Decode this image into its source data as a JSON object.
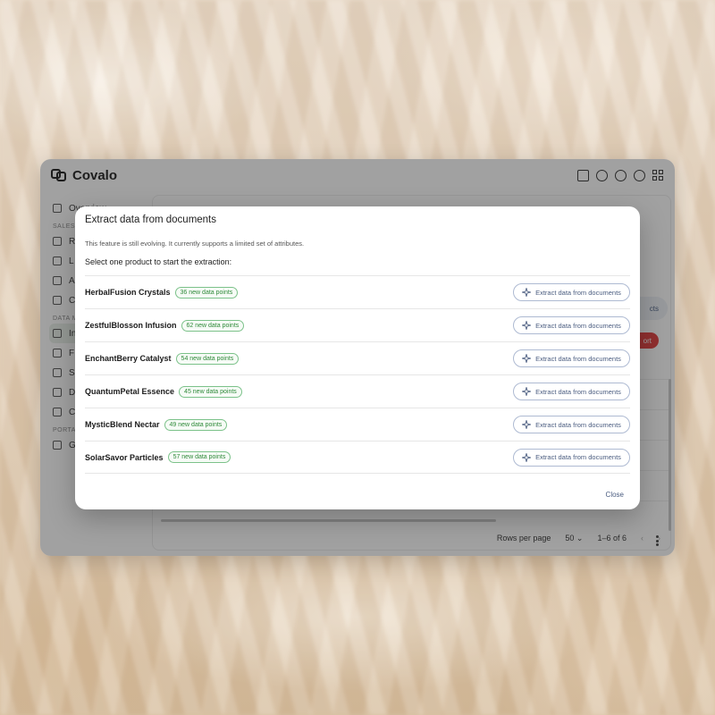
{
  "app": {
    "brand": "Covalo",
    "sidebar": {
      "overview": "Overview",
      "sections": [
        "SALES",
        "DATA M",
        "PORTA"
      ],
      "items": [
        "R",
        "L",
        "A",
        "C",
        "In",
        "F",
        "S",
        "D",
        "C",
        "G"
      ]
    },
    "chip_label": "cts",
    "red_label": "ort",
    "rows_per_page_label": "Rows per page",
    "rows_per_page_value": "50",
    "pagination_range": "1–6 of 6"
  },
  "modal": {
    "title": "Extract data from documents",
    "note": "This feature is still evolving. It currently supports a limited set of attributes.",
    "instruction": "Select one product to start the extraction:",
    "button_label": "Extract data from documents",
    "close_label": "Close",
    "products": [
      {
        "name": "HerbalFusion Crystals",
        "badge": "36 new data points"
      },
      {
        "name": "ZestfulBlosson Infusion",
        "badge": "62 new data points"
      },
      {
        "name": "EnchantBerry Catalyst",
        "badge": "54 new data points"
      },
      {
        "name": "QuantumPetal Essence",
        "badge": "45 new data points"
      },
      {
        "name": "MysticBlend Nectar",
        "badge": "49 new data points"
      },
      {
        "name": "SolarSavor Particles",
        "badge": "57 new data points"
      }
    ]
  },
  "colors": {
    "accent": "#4b5d80",
    "badge_green": "#2f8a3a",
    "danger": "#e23b3b"
  }
}
